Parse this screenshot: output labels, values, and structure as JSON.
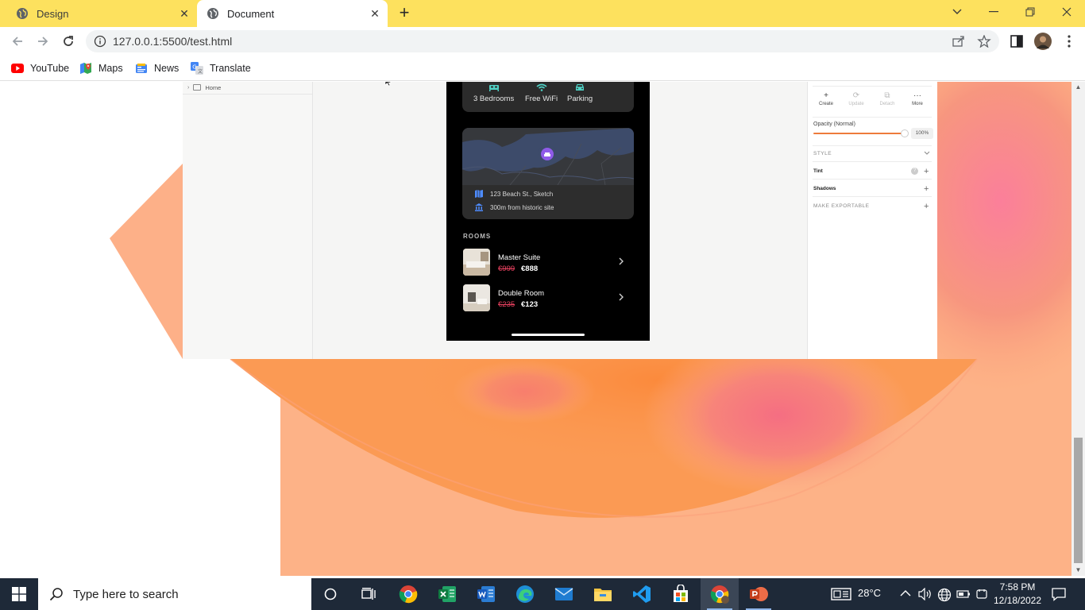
{
  "browser": {
    "tabs": [
      {
        "label": "Design",
        "active": false
      },
      {
        "label": "Document",
        "active": true
      }
    ],
    "url": "127.0.0.1:5500/test.html",
    "bookmarks": [
      {
        "label": "YouTube"
      },
      {
        "label": "Maps"
      },
      {
        "label": "News"
      },
      {
        "label": "Translate"
      }
    ]
  },
  "design": {
    "layers": {
      "home_label": "Home"
    },
    "phone": {
      "amenities": [
        {
          "label": "3 Bedrooms",
          "icon": "bed-icon"
        },
        {
          "label": "Free WiFi",
          "icon": "wifi-icon"
        },
        {
          "label": "Parking",
          "icon": "car-icon"
        }
      ],
      "location": {
        "address": "123 Beach St., Sketch",
        "landmark": "300m from historic site"
      },
      "rooms_title": "ROOMS",
      "rooms": [
        {
          "name": "Master Suite",
          "old_price": "€999",
          "new_price": "€888"
        },
        {
          "name": "Double Room",
          "old_price": "€235",
          "new_price": "€123"
        }
      ]
    },
    "inspector": {
      "actions": [
        "Create",
        "Update",
        "Detach",
        "More"
      ],
      "opacity_label": "Opacity (Normal)",
      "opacity_value": "100%",
      "opacity_fraction": 1.0,
      "sections": {
        "style": "STYLE",
        "tint": "Tint",
        "shadows": "Shadows",
        "exportable": "MAKE EXPORTABLE"
      }
    }
  },
  "taskbar": {
    "search_placeholder": "Type here to search",
    "temperature": "28°C",
    "time": "7:58 PM",
    "date": "12/18/2022"
  },
  "colors": {
    "tab_strip": "#fde15e",
    "accent_orange": "#ee7b3c",
    "price_red": "#e5405e",
    "pin_purple": "#8f5be8",
    "taskbar": "#1e2938"
  }
}
